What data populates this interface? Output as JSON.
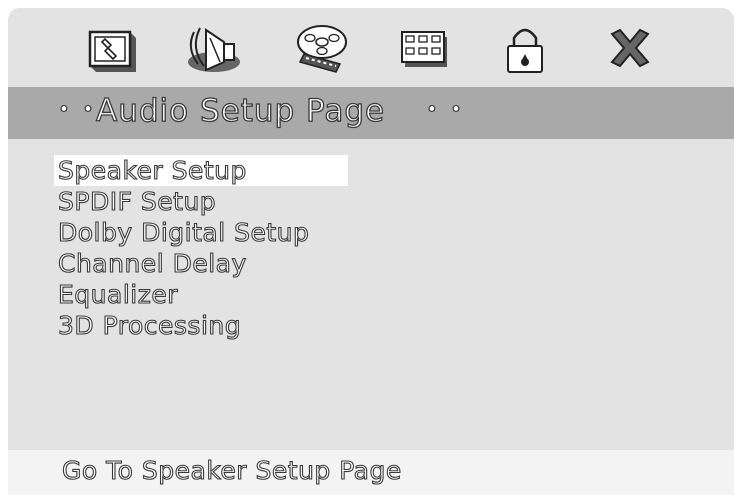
{
  "tabs": [
    {
      "icon": "general-setup-icon"
    },
    {
      "icon": "audio-setup-icon",
      "active": true
    },
    {
      "icon": "video-setup-icon"
    },
    {
      "icon": "preference-icon"
    },
    {
      "icon": "password-lock-icon"
    },
    {
      "icon": "exit-icon"
    }
  ],
  "header": {
    "dots_left": "• •",
    "title": "Audio Setup Page",
    "dots_right": "• •"
  },
  "menu": {
    "items": [
      {
        "label": "Speaker Setup",
        "selected": true
      },
      {
        "label": "SPDIF Setup"
      },
      {
        "label": "Dolby Digital Setup"
      },
      {
        "label": "Channel Delay"
      },
      {
        "label": "Equalizer"
      },
      {
        "label": "3D Processing"
      }
    ]
  },
  "status": {
    "text": "Go To Speaker Setup Page"
  },
  "colors": {
    "panel": "#e3e3e3",
    "title_bar": "#a9a9a9",
    "highlight": "#ffffff",
    "status_bar": "#f3f3f3"
  }
}
